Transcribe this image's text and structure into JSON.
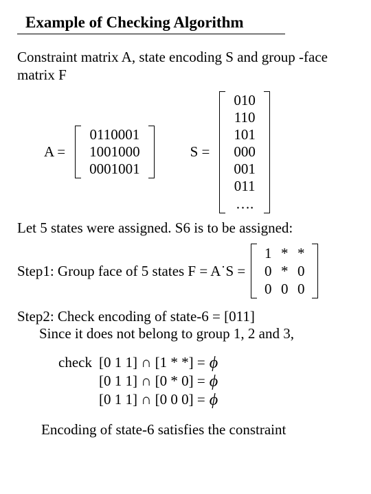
{
  "title": "Example of Checking Algorithm",
  "intro": "Constraint matrix A, state encoding S and group -face matrix F",
  "A": {
    "label": "A =",
    "rows": [
      "0110001",
      "1001000",
      "0001001"
    ]
  },
  "S": {
    "label": "S =",
    "rows": [
      "010",
      "110",
      "101",
      "000",
      "001",
      "011",
      "…."
    ]
  },
  "let_line": "Let 5 states were assigned. S6 is to be assigned:",
  "step1_prefix": "Step1: Group face of 5 states F = A˙S =",
  "F": [
    [
      "1",
      "*",
      "*"
    ],
    [
      "0",
      "*",
      "0"
    ],
    [
      "0",
      "0",
      "0"
    ]
  ],
  "step2_line1": "Step2: Check encoding of state-6 = [011]",
  "step2_line2": "Since it does not belong to group 1, 2 and 3,",
  "check_word": "check",
  "checks": [
    {
      "lhs": "[0 1 1]  ∩  [1 * *] =",
      "rhs": "ϕ"
    },
    {
      "lhs": "[0 1 1]  ∩  [0 * 0] =",
      "rhs": "ϕ"
    },
    {
      "lhs": "[0 1 1]  ∩  [0 0 0] =",
      "rhs": "ϕ"
    }
  ],
  "conclusion": "Encoding of state-6 satisfies the constraint"
}
